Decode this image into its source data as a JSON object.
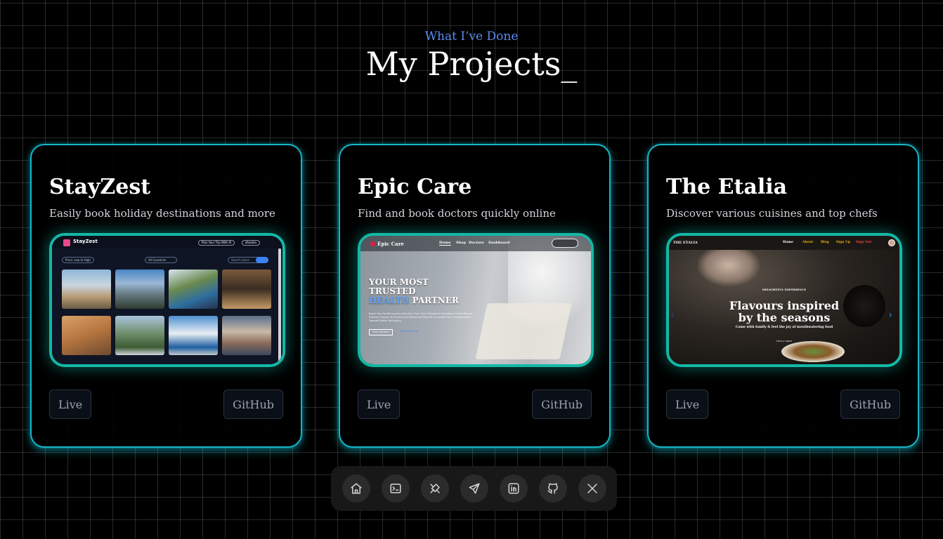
{
  "section": {
    "eyebrow": "What I’ve Done",
    "title": "My Projects_"
  },
  "projects": [
    {
      "title": "StayZest",
      "description": "Easily book holiday destinations and more",
      "live_label": "Live",
      "github_label": "GitHub",
      "screenshot": {
        "logo": "StayZest",
        "plan_button": "Plan Your Trip With AI",
        "user": "dhanika",
        "sort_select": "Price: Low to High",
        "country_select": "All Countries",
        "search_placeholder": "Search place"
      }
    },
    {
      "title": "Epic Care",
      "description": "Find and book doctors quickly online",
      "live_label": "Live",
      "github_label": "GitHub",
      "screenshot": {
        "logo": "Epic Care",
        "nav": [
          "Home",
          "Shop",
          "Doctors",
          "Dashboard"
        ],
        "headline_1": "YOUR MOST",
        "headline_2": "TRUSTED",
        "headline_3a": "HEALTH",
        "headline_3b": " PARTNER",
        "body": "Begin Your Health Journey with Epic Care, Your Gateway to Excellence in Healthcare. Explore a Range of Services and Resources Tailored to Support Your Transformation Towards Better Well-being.",
        "btn_1": "View Doctors",
        "btn_2": "Shop Products"
      }
    },
    {
      "title": "The Etalia",
      "description": "Discover various cuisines and top chefs",
      "live_label": "Live",
      "github_label": "GitHub",
      "screenshot": {
        "logo": "THE ETALIA",
        "nav": [
          "Home",
          "About",
          "Blog",
          "Sign Up",
          "Sign Out"
        ],
        "eyebrow": "DELIGHTFUL EXPERIENCE",
        "headline_1": "Flavours inspired",
        "headline_2": "by the seasons",
        "sub": "Come with family & feel the joy of mouthwatering food",
        "btn": "FIND A TABLE"
      }
    }
  ],
  "dock": {
    "items": [
      "home-icon",
      "terminal-icon",
      "tools-icon",
      "send-icon",
      "linkedin-icon",
      "github-icon",
      "x-icon"
    ]
  },
  "colors": {
    "accent": "#14b8c8",
    "eyebrow": "#5b8def",
    "background": "#000000"
  }
}
